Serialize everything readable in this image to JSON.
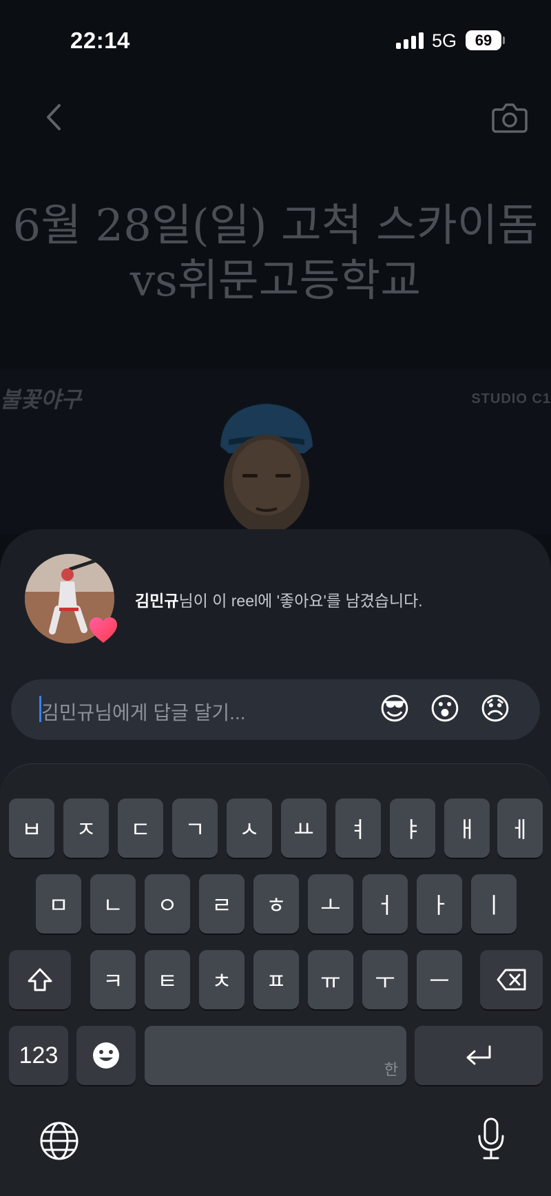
{
  "status": {
    "time": "22:14",
    "network": "5G",
    "battery": "69"
  },
  "video": {
    "title_line1": "6월 28일(일) 고척 스카이돔",
    "title_line2": "vs휘문고등학교",
    "logo_left": "불꽃야구",
    "logo_right": "STUDIO C1"
  },
  "notification": {
    "name": "김민규",
    "message": "님이 이 reel에 '좋아요'를 남겼습니다."
  },
  "reply": {
    "placeholder": "김민규님에게 답글 달기...",
    "emojis": [
      "😎",
      "😮",
      "😞"
    ]
  },
  "keyboard": {
    "row1": [
      "ㅂ",
      "ㅈ",
      "ㄷ",
      "ㄱ",
      "ㅅ",
      "ㅛ",
      "ㅕ",
      "ㅑ",
      "ㅐ",
      "ㅔ"
    ],
    "row2": [
      "ㅁ",
      "ㄴ",
      "ㅇ",
      "ㄹ",
      "ㅎ",
      "ㅗ",
      "ㅓ",
      "ㅏ",
      "ㅣ"
    ],
    "row3": [
      "ㅋ",
      "ㅌ",
      "ㅊ",
      "ㅍ",
      "ㅠ",
      "ㅜ",
      "ㅡ"
    ],
    "numbers_label": "123",
    "space_hint": "한"
  },
  "icons": {
    "back": "chevron-left-icon",
    "camera": "camera-icon",
    "heart": "heart-icon",
    "shift": "shift-icon",
    "delete": "backspace-icon",
    "emoji": "emoji-icon",
    "return": "return-icon",
    "globe": "globe-icon",
    "mic": "microphone-icon"
  }
}
